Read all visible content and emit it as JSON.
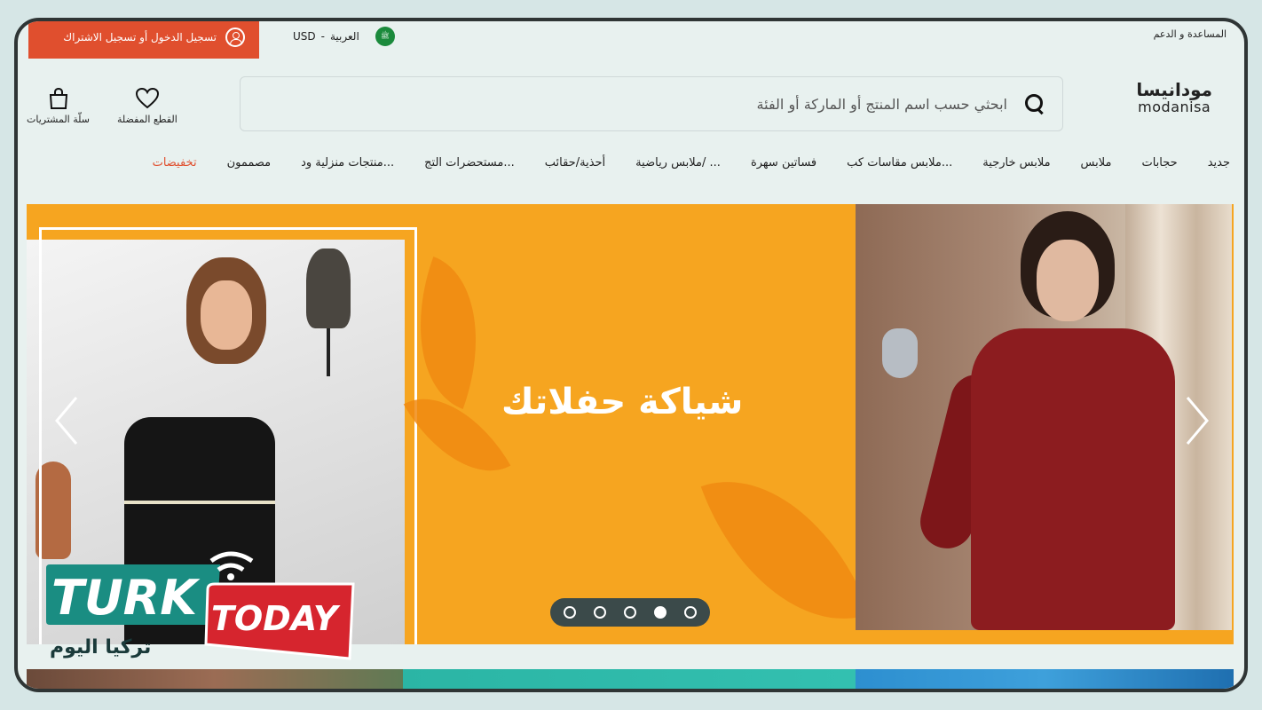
{
  "topbar": {
    "login_label": "تسجيل الدخول أو تسجيل الاشتراك",
    "language": "العربية",
    "currency": "USD",
    "locale_separator": "-",
    "flag_text": "ﷺ",
    "help_label": "المساعدة و الدعم"
  },
  "header": {
    "logo_ar": "مودانيسا",
    "logo_en": "modanisa",
    "search_placeholder": "ابحثي حسب اسم المنتج أو الماركة أو الفئة",
    "favorites_label": "القطع المفضلة",
    "cart_label": "سلّة المشتريات"
  },
  "nav": {
    "items": [
      "جديد",
      "حجابات",
      "ملابس",
      "ملابس خارجية",
      "ملابس مقاسات كب...",
      "فساتين سهرة",
      "ملابس رياضية/ ...",
      "أحذية/حقائب",
      "مستحضرات التج...",
      "منتجات منزلية ود...",
      "مصممون",
      "تخفيضات"
    ]
  },
  "hero": {
    "headline": "شياكة حفلاتك",
    "slides_count": 5,
    "active_slide": 4
  },
  "watermark": {
    "brand_1": "TURK",
    "brand_2": "TODAY",
    "arabic": "تركيا اليوم"
  },
  "colors": {
    "accent": "#e04f2e",
    "hero_bg": "#f6a520",
    "page_bg": "#e8f1ef"
  }
}
